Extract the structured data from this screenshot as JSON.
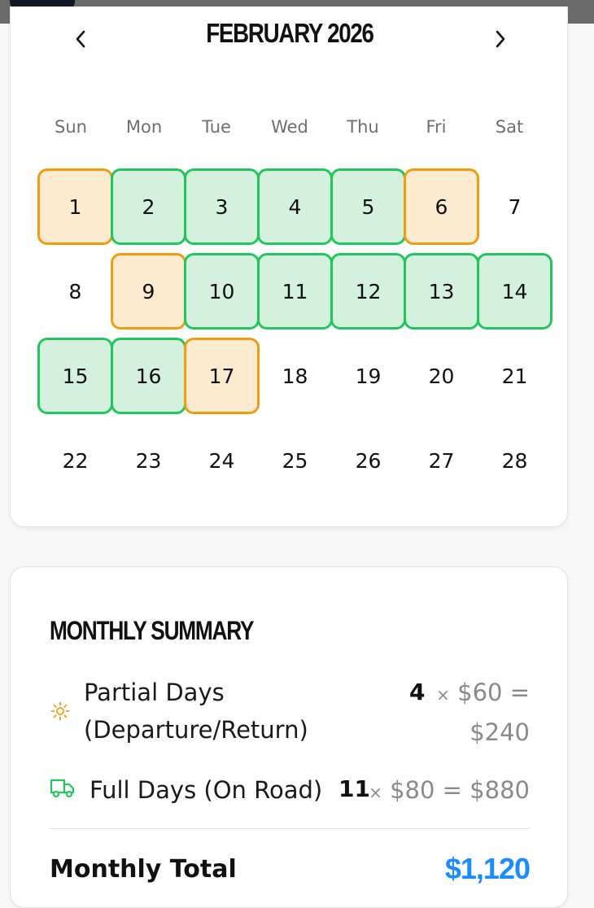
{
  "calendar": {
    "title": "FEBRUARY 2026",
    "prev_icon": "chevron-left-icon",
    "next_icon": "chevron-right-icon",
    "weekdays": [
      "Sun",
      "Mon",
      "Tue",
      "Wed",
      "Thu",
      "Fri",
      "Sat"
    ],
    "days": [
      {
        "n": "1",
        "type": "partial"
      },
      {
        "n": "2",
        "type": "full"
      },
      {
        "n": "3",
        "type": "full"
      },
      {
        "n": "4",
        "type": "full"
      },
      {
        "n": "5",
        "type": "full"
      },
      {
        "n": "6",
        "type": "partial"
      },
      {
        "n": "7",
        "type": "none"
      },
      {
        "n": "8",
        "type": "none"
      },
      {
        "n": "9",
        "type": "partial"
      },
      {
        "n": "10",
        "type": "full"
      },
      {
        "n": "11",
        "type": "full"
      },
      {
        "n": "12",
        "type": "full"
      },
      {
        "n": "13",
        "type": "full"
      },
      {
        "n": "14",
        "type": "full"
      },
      {
        "n": "15",
        "type": "full"
      },
      {
        "n": "16",
        "type": "full"
      },
      {
        "n": "17",
        "type": "partial"
      },
      {
        "n": "18",
        "type": "none"
      },
      {
        "n": "19",
        "type": "none"
      },
      {
        "n": "20",
        "type": "none"
      },
      {
        "n": "21",
        "type": "none"
      },
      {
        "n": "22",
        "type": "none"
      },
      {
        "n": "23",
        "type": "none"
      },
      {
        "n": "24",
        "type": "none"
      },
      {
        "n": "25",
        "type": "none"
      },
      {
        "n": "26",
        "type": "none"
      },
      {
        "n": "27",
        "type": "none"
      },
      {
        "n": "28",
        "type": "none"
      }
    ],
    "colors": {
      "partial_fill": "#fdebd0",
      "partial_border": "#f39c12",
      "full_fill": "#d4f1de",
      "full_border": "#22c55e"
    }
  },
  "summary": {
    "title": "MONTHLY SUMMARY",
    "partial": {
      "icon": "sun-icon",
      "label_line1": "Partial Days",
      "label_line2": "(Departure/Return)",
      "count": "4",
      "times": "×",
      "rate": "$60 =",
      "amount": "$240"
    },
    "full": {
      "icon": "truck-icon",
      "label": "Full Days (On Road)",
      "count": "11",
      "times": "×",
      "calc": "$80 = $880"
    },
    "total_label": "Monthly Total",
    "total_value": "$1,120",
    "accent": "#1a8cff"
  }
}
